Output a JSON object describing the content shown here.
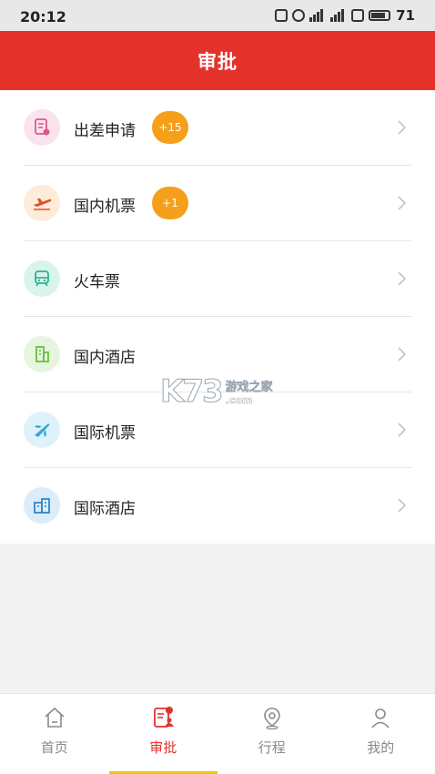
{
  "status_bar": {
    "time": "20:12",
    "battery": "71"
  },
  "header": {
    "title": "审批"
  },
  "items": [
    {
      "label": "出差申请",
      "badge": "+15",
      "icon": "document-stamp-icon",
      "icon_bg": "#fbe3ee",
      "icon_color": "#d95a8a"
    },
    {
      "label": "国内机票",
      "badge": "+1",
      "icon": "plane-takeoff-icon",
      "icon_bg": "#fdecd9",
      "icon_color": "#e0522a"
    },
    {
      "label": "火车票",
      "badge": "",
      "icon": "train-icon",
      "icon_bg": "#d9f4ec",
      "icon_color": "#2bb38a"
    },
    {
      "label": "国内酒店",
      "badge": "",
      "icon": "building-icon",
      "icon_bg": "#e5f5de",
      "icon_color": "#6abf45"
    },
    {
      "label": "国际机票",
      "badge": "",
      "icon": "plane-icon",
      "icon_bg": "#def2fb",
      "icon_color": "#3aa5d8"
    },
    {
      "label": "国际酒店",
      "badge": "",
      "icon": "hotel-icon",
      "icon_bg": "#dcecf8",
      "icon_color": "#2f86c8"
    }
  ],
  "watermark": {
    "logo": "K73",
    "cn": "游戏之家",
    "en": ".com"
  },
  "tabs": [
    {
      "label": "首页",
      "icon": "home-icon",
      "active": false
    },
    {
      "label": "审批",
      "icon": "approval-icon",
      "active": true
    },
    {
      "label": "行程",
      "icon": "location-pin-icon",
      "active": false
    },
    {
      "label": "我的",
      "icon": "user-icon",
      "active": false
    }
  ],
  "colors": {
    "accent": "#e4322b",
    "badge": "#f5a01a",
    "tab_indicator": "#f5c400"
  }
}
